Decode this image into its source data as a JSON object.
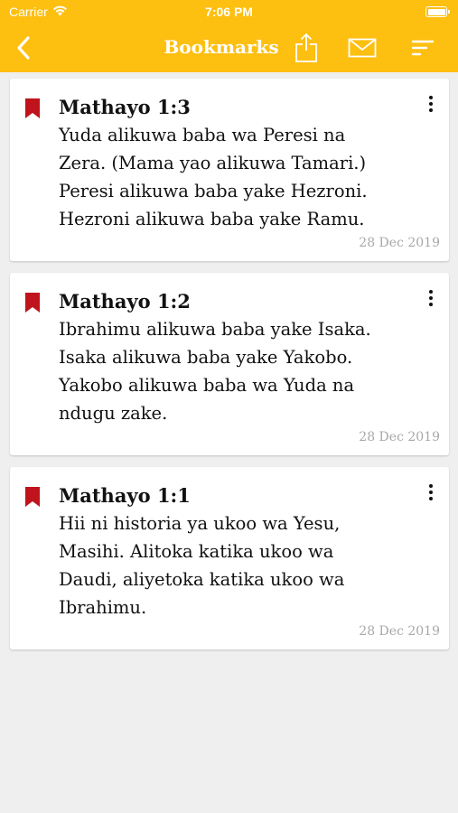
{
  "status_bar": {
    "carrier": "Carrier",
    "time": "7:06 PM"
  },
  "navbar": {
    "title": "Bookmarks",
    "back_icon": "chevron-left-icon",
    "share_icon": "share-icon",
    "mail_icon": "mail-icon",
    "sort_icon": "sort-icon"
  },
  "colors": {
    "accent": "#fdbf10",
    "bookmark": "#c0141c",
    "background": "#efeff0",
    "date_text": "#a8a8a8"
  },
  "bookmarks": [
    {
      "reference": "Mathayo 1:3",
      "lines": [
        "Yuda alikuwa baba wa Peresi na",
        "Zera. (Mama yao alikuwa Tamari.)",
        "Peresi alikuwa baba yake Hezroni.",
        "Hezroni alikuwa baba yake Ramu."
      ],
      "date": "28 Dec 2019"
    },
    {
      "reference": "Mathayo 1:2",
      "lines": [
        "Ibrahimu alikuwa baba yake Isaka.",
        "Isaka alikuwa baba yake Yakobo.",
        "Yakobo alikuwa baba wa Yuda na",
        "ndugu zake."
      ],
      "date": "28 Dec 2019"
    },
    {
      "reference": "Mathayo 1:1",
      "lines": [
        "Hii ni historia ya ukoo wa Yesu,",
        "Masihi. Alitoka katika ukoo wa",
        "Daudi, aliyetoka katika ukoo wa",
        "Ibrahimu."
      ],
      "date": "28 Dec 2019"
    }
  ]
}
